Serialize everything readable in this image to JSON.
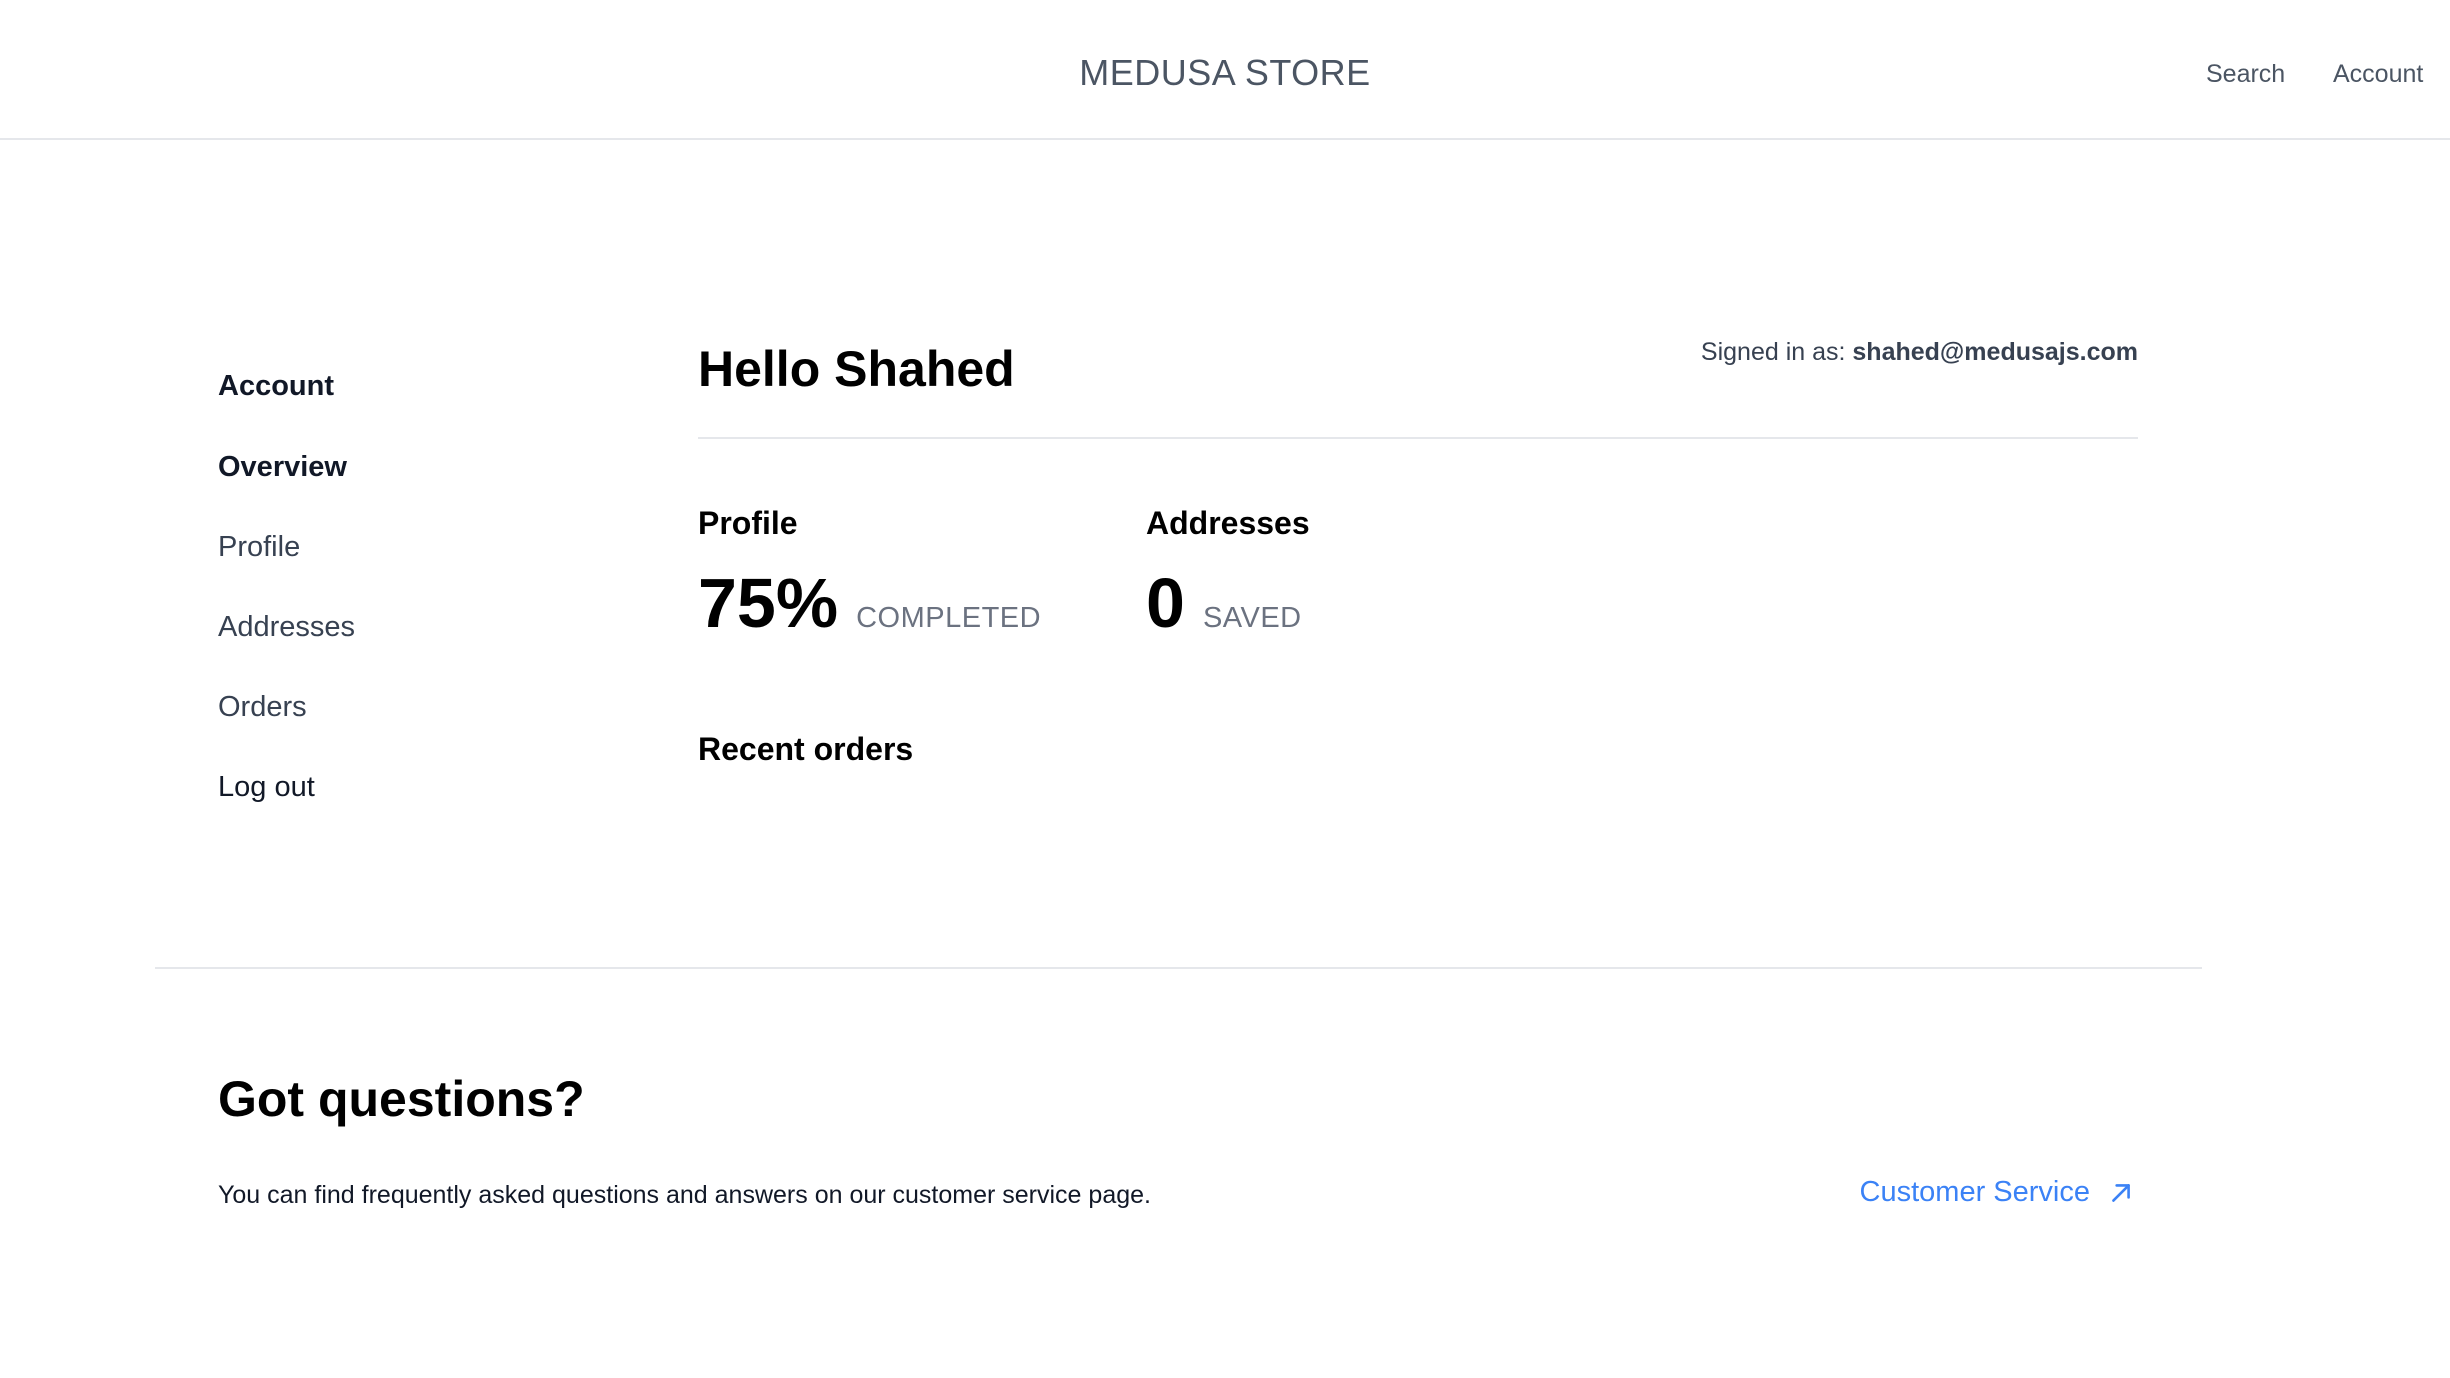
{
  "header": {
    "brand": "MEDUSA STORE",
    "nav": [
      {
        "label": "Search"
      },
      {
        "label": "Account"
      }
    ]
  },
  "sidebar": {
    "title": "Account",
    "items": [
      {
        "label": "Overview",
        "active": true
      },
      {
        "label": "Profile"
      },
      {
        "label": "Addresses"
      },
      {
        "label": "Orders"
      },
      {
        "label": "Log out"
      }
    ]
  },
  "main": {
    "greeting": "Hello Shahed",
    "signed_in_label": "Signed in as:",
    "signed_in_email": "shahed@medusajs.com",
    "stats": [
      {
        "label": "Profile",
        "value": "75%",
        "suffix": "COMPLETED"
      },
      {
        "label": "Addresses",
        "value": "0",
        "suffix": "SAVED"
      }
    ],
    "recent_orders_title": "Recent orders"
  },
  "footer": {
    "title": "Got questions?",
    "text": "You can find frequently asked questions and answers on our customer service page.",
    "link_label": "Customer Service",
    "link_icon": "arrow-up-right-icon",
    "link_color": "#3b82f6"
  }
}
